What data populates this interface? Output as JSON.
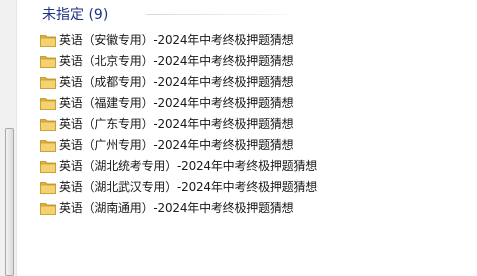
{
  "group": {
    "title": "未指定 (9)"
  },
  "icons": {
    "folder": "folder-icon"
  },
  "files": [
    {
      "label": "英语（安徽专用）-2024年中考终极押题猜想"
    },
    {
      "label": "英语（北京专用）-2024年中考终极押题猜想"
    },
    {
      "label": "英语（成都专用）-2024年中考终极押题猜想"
    },
    {
      "label": "英语（福建专用）-2024年中考终极押题猜想"
    },
    {
      "label": "英语（广东专用）-2024年中考终极押题猜想"
    },
    {
      "label": "英语（广州专用）-2024年中考终极押题猜想"
    },
    {
      "label": "英语（湖北统考专用）-2024年中考终极押题猜想"
    },
    {
      "label": "英语（湖北武汉专用）-2024年中考终极押题猜想"
    },
    {
      "label": "英语（湖南通用）-2024年中考终极押题猜想"
    }
  ]
}
